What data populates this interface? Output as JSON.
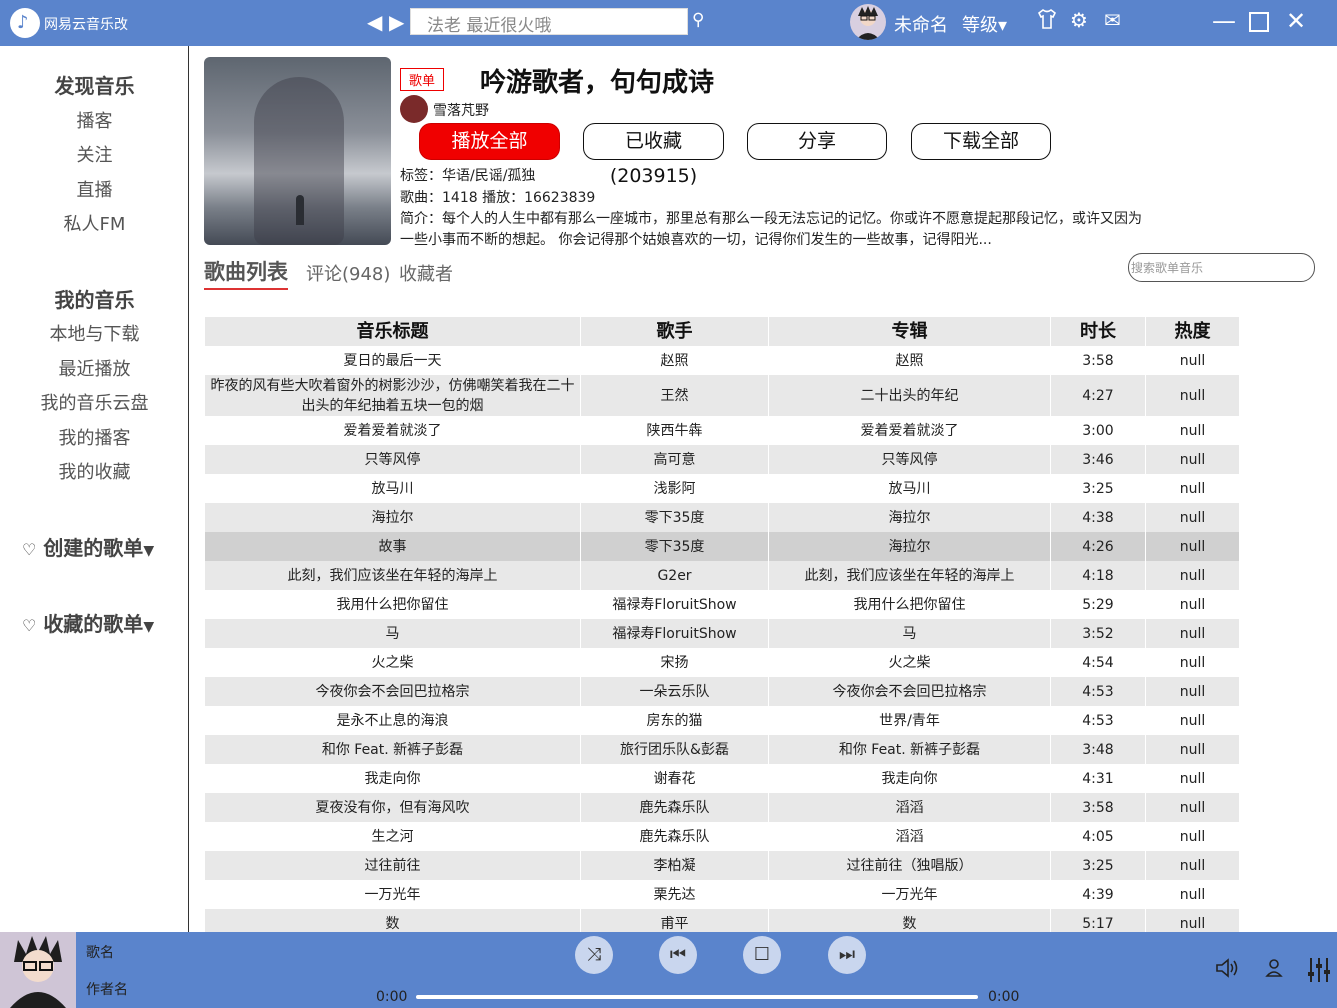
{
  "app": {
    "title": "网易云音乐改",
    "logo_glyph": "♪",
    "search_placeholder": "法老 最近很火哦",
    "username": "未命名",
    "level_label": "等级",
    "accent_color": "#5a84cc"
  },
  "sidebar": {
    "discover_heading": "发现音乐",
    "discover_items": [
      "播客",
      "关注",
      "直播",
      "私人FM"
    ],
    "my_music_heading": "我的音乐",
    "my_music_items": [
      "本地与下载",
      "最近播放",
      "我的音乐云盘",
      "我的播客",
      "我的收藏"
    ],
    "created_playlists": "创建的歌单",
    "collected_playlists": "收藏的歌单"
  },
  "playlist": {
    "badge": "歌单",
    "title": "吟游歌者，句句成诗",
    "creator": "雪落芃野",
    "play_all": "播放全部",
    "collected": "已收藏(203915)",
    "share": "分享",
    "download_all": "下载全部",
    "tags": "标签：华语/民谣/孤独",
    "stats": "歌曲：1418 播放：16623839",
    "description": "简介：每个人的人生中都有那么一座城市，那里总有那么一段无法忘记的记忆。你或许不愿意提起那段记忆，或许又因为一些小事而不断的想起。 你会记得那个姑娘喜欢的一切，记得你们发生的一些故事，记得阳光..."
  },
  "tabs": {
    "songs": "歌曲列表",
    "comments": "评论(948)",
    "collectors": "收藏者",
    "search_placeholder": "搜索歌单音乐"
  },
  "table": {
    "headers": [
      "音乐标题",
      "歌手",
      "专辑",
      "时长",
      "热度"
    ],
    "rows": [
      [
        "夏日的最后一天",
        "赵照",
        "赵照",
        "3:58",
        "null"
      ],
      [
        "昨夜的风有些大吹着窗外的树影沙沙，仿佛嘲笑着我在二十出头的年纪抽着五块一包的烟",
        "王然",
        "二十出头的年纪",
        "4:27",
        "null"
      ],
      [
        "爱着爱着就淡了",
        "陕西牛犇",
        "爱着爱着就淡了",
        "3:00",
        "null"
      ],
      [
        "只等风停",
        "高可意",
        "只等风停",
        "3:46",
        "null"
      ],
      [
        "放马川",
        "浅影阿",
        "放马川",
        "3:25",
        "null"
      ],
      [
        "海拉尔",
        "零下35度",
        "海拉尔",
        "4:38",
        "null"
      ],
      [
        "故事",
        "零下35度",
        "海拉尔",
        "4:26",
        "null"
      ],
      [
        "此刻，我们应该坐在年轻的海岸上",
        "G2er",
        "此刻，我们应该坐在年轻的海岸上",
        "4:18",
        "null"
      ],
      [
        "我用什么把你留住",
        "福禄寿FloruitShow",
        "我用什么把你留住",
        "5:29",
        "null"
      ],
      [
        "马",
        "福禄寿FloruitShow",
        "马",
        "3:52",
        "null"
      ],
      [
        "火之柴",
        "宋扬",
        "火之柴",
        "4:54",
        "null"
      ],
      [
        "今夜你会不会回巴拉格宗",
        "一朵云乐队",
        "今夜你会不会回巴拉格宗",
        "4:53",
        "null"
      ],
      [
        "是永不止息的海浪",
        "房东的猫",
        "世界/青年",
        "4:53",
        "null"
      ],
      [
        "和你 Feat. 新裤子彭磊",
        "旅行团乐队&彭磊",
        "和你 Feat. 新裤子彭磊",
        "3:48",
        "null"
      ],
      [
        "我走向你",
        "谢春花",
        "我走向你",
        "4:31",
        "null"
      ],
      [
        "夏夜没有你，但有海风吹",
        "鹿先森乐队",
        "滔滔",
        "3:58",
        "null"
      ],
      [
        "生之河",
        "鹿先森乐队",
        "滔滔",
        "4:05",
        "null"
      ],
      [
        "过往前往",
        "李柏凝",
        "过往前往（独唱版）",
        "3:25",
        "null"
      ],
      [
        "一万光年",
        "栗先达",
        "一万光年",
        "4:39",
        "null"
      ],
      [
        "数",
        "甫平",
        "数",
        "5:17",
        "null"
      ]
    ]
  },
  "player": {
    "song_name": "歌名",
    "artist_name": "作者名",
    "time_current": "0:00",
    "time_total": "0:00",
    "progress": 0
  }
}
